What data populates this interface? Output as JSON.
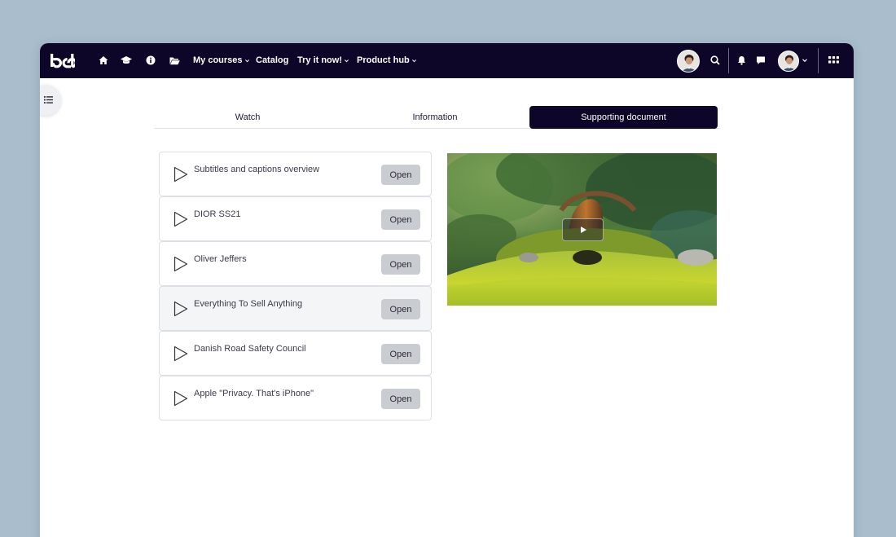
{
  "nav": {
    "links": [
      {
        "label": "My courses",
        "has_caret": true
      },
      {
        "label": "Catalog",
        "has_caret": false
      },
      {
        "label": "Try it now!",
        "has_caret": true
      },
      {
        "label": "Product hub",
        "has_caret": true
      }
    ],
    "icons": [
      "home-icon",
      "graduation-cap-icon",
      "info-icon",
      "folder-icon",
      "search-icon",
      "bell-icon",
      "chat-icon",
      "apps-grid-icon",
      "list-icon"
    ]
  },
  "tabs": [
    {
      "label": "Watch",
      "active": false
    },
    {
      "label": "Information",
      "active": false
    },
    {
      "label": "Supporting document",
      "active": true
    }
  ],
  "videos": [
    {
      "title": "Subtitles and captions overview",
      "button": "Open"
    },
    {
      "title": "DIOR SS21",
      "button": "Open"
    },
    {
      "title": "Oliver Jeffers",
      "button": "Open"
    },
    {
      "title": "Everything To Sell Anything",
      "button": "Open"
    },
    {
      "title": "Danish Road Safety Council",
      "button": "Open"
    },
    {
      "title": "Apple \"Privacy. That's iPhone\"",
      "button": "Open"
    }
  ],
  "colors": {
    "navbar": "#0d0628",
    "active_tab": "#0d0628",
    "open_button": "#c9ccd1",
    "page_background": "#a9bdcc"
  }
}
